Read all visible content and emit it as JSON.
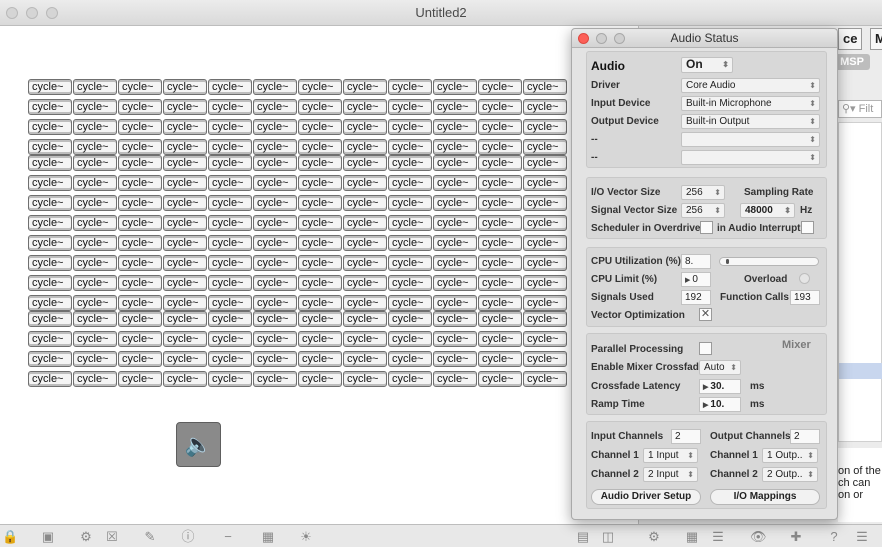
{
  "window": {
    "title": "Untitled2",
    "traffic_lights": [
      "close",
      "minimize",
      "zoom"
    ]
  },
  "patcher": {
    "object_label": "cycle~",
    "rows": 16,
    "cols": 12,
    "speaker_icon": "speaker-icon"
  },
  "side_window": {
    "tab1": "ce",
    "tab2": "M",
    "msp_label": "MSP",
    "search_placeholder": "Filt",
    "help_line1": "on of the",
    "help_line2": "ch can",
    "help_line3": "on or"
  },
  "audio_status": {
    "title": "Audio Status",
    "audio_label": "Audio",
    "audio_value": "On",
    "driver_label": "Driver",
    "driver_value": "Core Audio",
    "input_device_label": "Input Device",
    "input_device_value": "Built-in Microphone",
    "output_device_label": "Output Device",
    "output_device_value": "Built-in Output",
    "blank1_label": "--",
    "blank2_label": "--",
    "io_vector_label": "I/O Vector Size",
    "io_vector_value": "256",
    "sampling_rate_label": "Sampling Rate",
    "signal_vector_label": "Signal Vector Size",
    "signal_vector_value": "256",
    "sampling_rate_value": "48000",
    "hz_label": "Hz",
    "overdrive_label": "Scheduler in Overdrive",
    "interrupt_label": "in Audio Interrupt",
    "cpu_util_label": "CPU Utilization (%)",
    "cpu_util_value": "8.",
    "cpu_util_fraction": 0.08,
    "cpu_limit_label": "CPU Limit (%)",
    "cpu_limit_value": "0",
    "overload_label": "Overload",
    "signals_used_label": "Signals Used",
    "signals_used_value": "192",
    "function_calls_label": "Function Calls",
    "function_calls_value": "193",
    "vector_opt_label": "Vector Optimization",
    "vector_opt_mark": "✕",
    "parallel_label": "Parallel Processing",
    "mixer_label": "Mixer",
    "mixer_crossfade_label": "Enable Mixer Crossfade",
    "mixer_crossfade_value": "Auto",
    "crossfade_latency_label": "Crossfade Latency",
    "crossfade_latency_value": "30.",
    "ms1": "ms",
    "ramp_time_label": "Ramp Time",
    "ramp_time_value": "10.",
    "ms2": "ms",
    "input_channels_label": "Input Channels",
    "input_channels_value": "2",
    "output_channels_label": "Output Channels",
    "output_channels_value": "2",
    "in_ch1_label": "Channel 1",
    "in_ch1_value": "1 Input",
    "out_ch1_label": "Channel 1",
    "out_ch1_value": "1 Outp..",
    "in_ch2_label": "Channel 2",
    "in_ch2_value": "2 Input",
    "out_ch2_label": "Channel 2",
    "out_ch2_value": "2 Outp..",
    "driver_setup_label": "Audio Driver Setup",
    "io_mappings_label": "I/O Mappings"
  },
  "toolbar_icons": [
    "lock-icon",
    "presentation-icon",
    "new-object-icon",
    "clear-icon",
    "edit-icon",
    "info-icon",
    "connect-icon",
    "grid-icon",
    "debug-icon",
    "split-icon",
    "sidebar-icon",
    "gear-icon",
    "grid-view-icon",
    "list-view-icon",
    "eye-icon",
    "add-icon",
    "help-icon",
    "menu-icon"
  ]
}
